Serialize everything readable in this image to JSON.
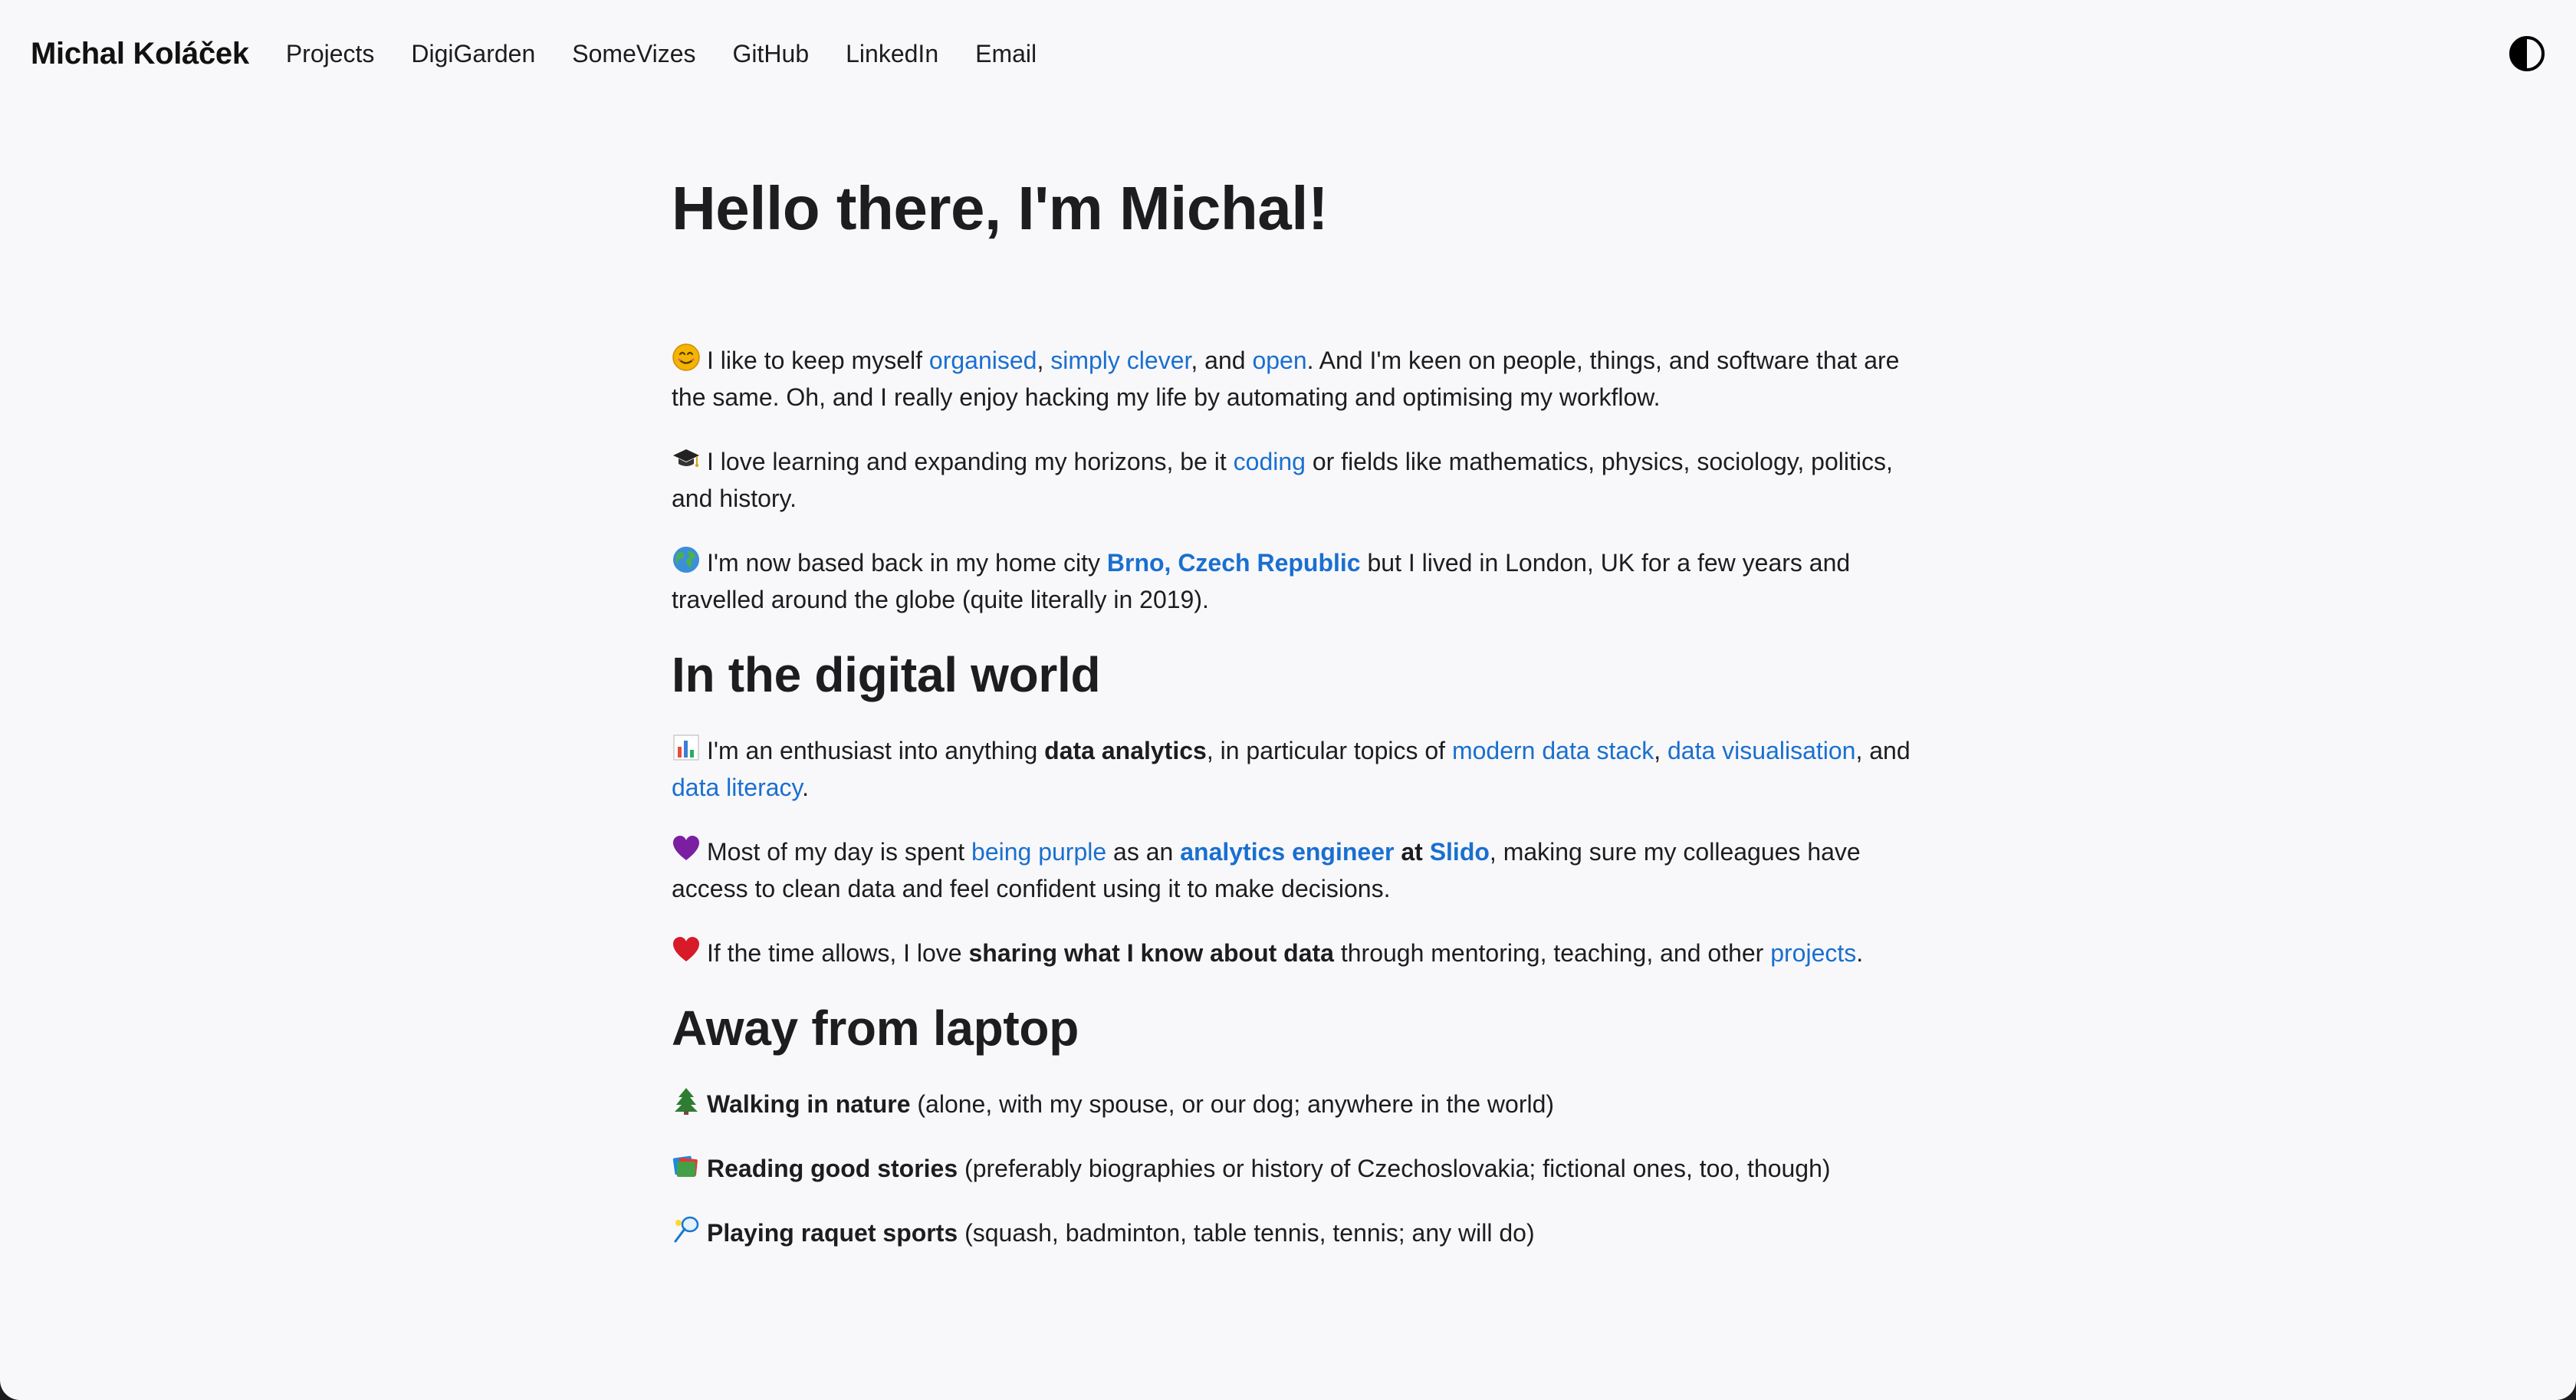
{
  "header": {
    "brand": "Michal Koláček",
    "nav": [
      "Projects",
      "DigiGarden",
      "SomeVizes",
      "GitHub",
      "LinkedIn",
      "Email"
    ],
    "theme_toggle_icon": "contrast-icon"
  },
  "title": "Hello there, I'm Michal!",
  "intro": {
    "p1": {
      "icon": "smiling-face-icon",
      "t1": "I like to keep myself ",
      "l1": "organised",
      "t2": ", ",
      "l2": "simply clever",
      "t3": ", and ",
      "l3": "open",
      "t4": ". And I'm keen on people, things, and software that are the same. Oh, and I really enjoy hacking my life by automating and optimising my workflow."
    },
    "p2": {
      "icon": "graduation-cap-icon",
      "t1": "I love learning and expanding my horizons, be it ",
      "l1": "coding",
      "t2": " or fields like mathematics, physics, sociology, politics, and history."
    },
    "p3": {
      "icon": "globe-icon",
      "t1": "I'm now based back in my home city ",
      "l1": "Brno, Czech Republic",
      "t2": " but I lived in London, UK for a few years and travelled around the globe (quite literally in 2019)."
    }
  },
  "digital": {
    "heading": "In the digital world",
    "p1": {
      "icon": "bar-chart-icon",
      "t1": "I'm an enthusiast into anything ",
      "b1": "data analytics",
      "t2": ", in particular topics of ",
      "l1": "modern data stack",
      "t3": ", ",
      "l2": "data visualisation",
      "t4": ", and ",
      "l3": "data literacy",
      "t5": "."
    },
    "p2": {
      "icon": "purple-heart-icon",
      "t1": "Most of my day is spent ",
      "l1": "being purple",
      "t2": " as an ",
      "l2": "analytics engineer",
      "b1": " at ",
      "l3": "Slido",
      "t3": ", making sure my colleagues have access to clean data and feel confident using it to make decisions."
    },
    "p3": {
      "icon": "red-heart-icon",
      "t1": "If the time allows, I love ",
      "b1": "sharing what I know about data",
      "t2": " through mentoring, teaching, and other ",
      "l1": "projects",
      "t3": "."
    }
  },
  "away": {
    "heading": "Away from laptop",
    "p1": {
      "icon": "evergreen-tree-icon",
      "b1": "Walking in nature",
      "t1": " (alone, with my spouse, or our dog; anywhere in the world)"
    },
    "p2": {
      "icon": "books-icon",
      "b1": "Reading good stories",
      "t1": " (preferably biographies or history of Czechoslovakia; fictional ones, too, though)"
    },
    "p3": {
      "icon": "badminton-icon",
      "b1": "Playing raquet sports",
      "t1": " (squash, badminton, table tennis, tennis; any will do)"
    }
  },
  "colors": {
    "background": "#f8f8fa",
    "text": "#1d1d1f",
    "link": "#1a6fd0"
  }
}
